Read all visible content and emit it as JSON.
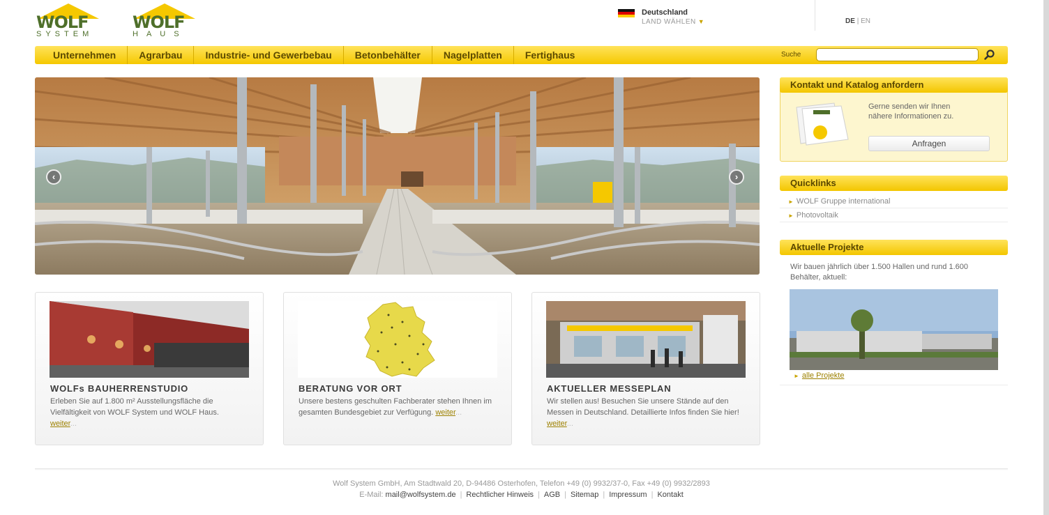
{
  "brand": {
    "logo1": {
      "mark": "WOLF",
      "sub": "SYSTEM"
    },
    "logo2": {
      "mark": "WOLF",
      "sub": "HAUS"
    }
  },
  "country": {
    "name": "Deutschland",
    "choose": "LAND WÄHLEN"
  },
  "languages": {
    "active": "DE",
    "separator": "|",
    "other": "EN"
  },
  "nav": {
    "items": [
      "Unternehmen",
      "Agrarbau",
      "Industrie- und Gewerbebau",
      "Betonbehälter",
      "Nagelplatten",
      "Fertighaus"
    ],
    "search_label": "Suche",
    "search_value": ""
  },
  "teasers": [
    {
      "title": "WOLFs BAUHERRENSTUDIO",
      "text": "Erleben Sie auf 1.800 m² Ausstellungsfläche die Vielfältigkeit von WOLF System und WOLF Haus.",
      "link": "weiter",
      "ellipsis": "..."
    },
    {
      "title": "BERATUNG VOR ORT",
      "text": "Unsere bestens geschulten Fachberater stehen Ihnen im gesamten Bundesgebiet zur Verfügung.",
      "link": "weiter",
      "ellipsis": "..."
    },
    {
      "title": "AKTUELLER MESSEPLAN",
      "text": "Wir stellen aus! Besuchen Sie unsere Stände auf den Messen in Deutschland. Detaillierte Infos finden Sie hier!",
      "link": "weiter",
      "ellipsis": "..."
    }
  ],
  "contact": {
    "heading": "Kontakt und Katalog anfordern",
    "text": "Gerne senden wir Ihnen nähere Informationen zu.",
    "button": "Anfragen"
  },
  "quicklinks": {
    "heading": "Quicklinks",
    "items": [
      "WOLF Gruppe international",
      "Photovoltaik"
    ]
  },
  "projects": {
    "heading": "Aktuelle Projekte",
    "text": "Wir bauen jährlich über 1.500 Hallen und rund 1.600 Behälter, aktuell:",
    "link": "alle Projekte"
  },
  "footer": {
    "address": "Wolf System GmbH, Am Stadtwald 20, D-94486 Osterhofen, Telefon +49 (0) 9932/37-0, Fax +49 (0) 9932/2893",
    "email_label": "E-Mail:",
    "email": "mail@wolfsystem.de",
    "links": [
      "Rechtlicher Hinweis",
      "AGB",
      "Sitemap",
      "Impressum",
      "Kontakt"
    ]
  },
  "colors": {
    "accent": "#f5c800",
    "brand_green": "#4e6f2a",
    "link": "#9c8000"
  },
  "icons": {
    "search": "search-icon",
    "prev": "arrow-left-icon",
    "next": "arrow-right-icon"
  }
}
